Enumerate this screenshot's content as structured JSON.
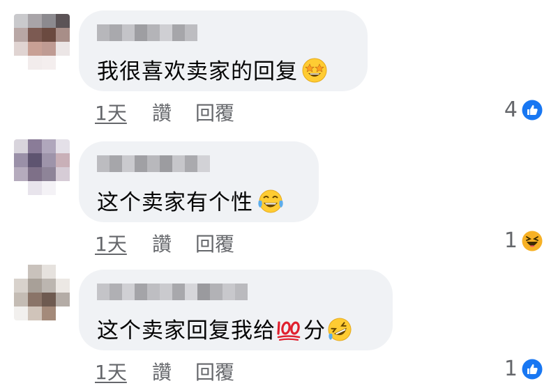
{
  "comments": [
    {
      "text": "我很喜欢卖家的回复",
      "emoji": "star-struck",
      "time": "1天",
      "like_label": "讚",
      "reply_label": "回覆",
      "reaction_count": "4",
      "reaction_type": "like"
    },
    {
      "text": "这个卖家有个性",
      "emoji": "tears-of-joy",
      "time": "1天",
      "like_label": "讚",
      "reply_label": "回覆",
      "reaction_count": "1",
      "reaction_type": "haha"
    },
    {
      "text": "这个卖家回复我给",
      "text_suffix": "分",
      "emoji_inline": "hundred-points",
      "emoji": "rolling-on-floor-laughing",
      "time": "1天",
      "like_label": "讚",
      "reply_label": "回覆",
      "reaction_count": "1",
      "reaction_type": "like"
    }
  ],
  "colors": {
    "like_blue": "#1877f2",
    "haha_yellow": "#f7b125",
    "bubble_bg": "#f0f2f5",
    "meta_text": "#65676b"
  }
}
